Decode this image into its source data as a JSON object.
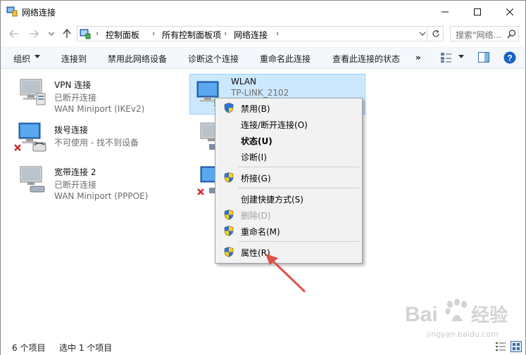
{
  "window": {
    "title": "网络连接"
  },
  "address": {
    "crumbs": [
      "控制面板",
      "所有控制面板项",
      "网络连接"
    ],
    "search_placeholder": "搜索\"网络..."
  },
  "commands": {
    "organize": "组织",
    "connect_to": "连接到",
    "disable": "禁用此网络设备",
    "diagnose": "诊断这个连接",
    "rename": "重命名此连接",
    "view_status": "查看此连接的状态",
    "more": "»"
  },
  "connections": [
    {
      "name": "VPN 连接",
      "status": "已断开连接",
      "device": "WAN Miniport (IKEv2)"
    },
    {
      "name": "WLAN",
      "status": "TP-LINK_2102",
      "device": ""
    },
    {
      "name": "拨号连接",
      "status": "不可使用 - 找不到设备",
      "device": ""
    },
    {
      "name": "",
      "status": "",
      "device": ""
    },
    {
      "name": "宽带连接 2",
      "status": "已断开连接",
      "device": "WAN Miniport (PPPOE)"
    },
    {
      "name": "",
      "status": "",
      "device": ""
    }
  ],
  "context_menu": {
    "items": [
      {
        "label": "禁用(B)",
        "shield": true
      },
      {
        "label": "连接/断开连接(O)",
        "shield": false
      },
      {
        "label": "状态(U)",
        "shield": false,
        "bold": true
      },
      {
        "label": "诊断(I)",
        "shield": false
      },
      {
        "label": "桥接(G)",
        "shield": true
      },
      {
        "label": "创建快捷方式(S)",
        "shield": false
      },
      {
        "label": "删除(D)",
        "shield": true,
        "disabled": true
      },
      {
        "label": "重命名(M)",
        "shield": true
      },
      {
        "label": "属性(R)",
        "shield": true
      }
    ]
  },
  "statusbar": {
    "item_count": "6 个项目",
    "selected": "选中 1 个项目"
  },
  "watermark": {
    "brand": "Baidu经验",
    "url": "jingyan.baidu.com"
  },
  "colors": {
    "selection": "#cce8ff",
    "selection_border": "#99d1ff",
    "arrow": "#e0504a",
    "help_blue": "#1a62c4"
  }
}
